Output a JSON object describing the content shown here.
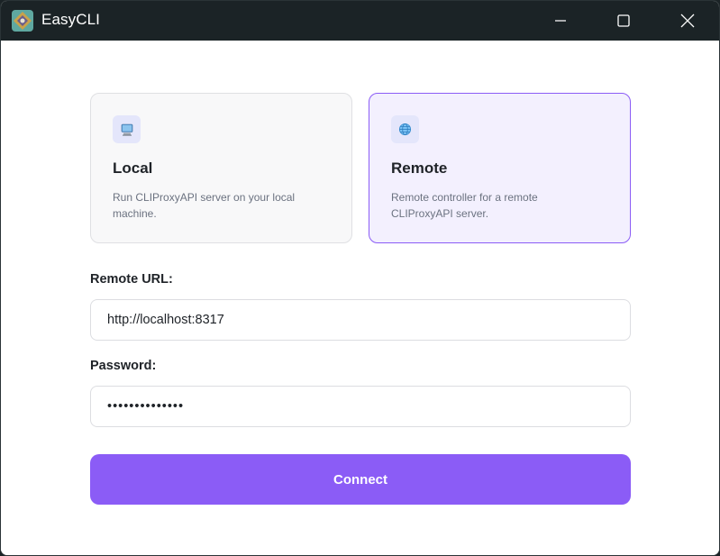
{
  "window": {
    "title": "EasyCLI",
    "controls": {
      "minimize": "minimize-icon",
      "maximize": "maximize-icon",
      "close": "close-icon"
    }
  },
  "modes": [
    {
      "title": "Local",
      "description": "Run CLIProxyAPI server on your local machine.",
      "icon": "computer-icon",
      "selected": false
    },
    {
      "title": "Remote",
      "description": "Remote controller for a remote CLIProxyAPI server.",
      "icon": "globe-icon",
      "selected": true
    }
  ],
  "form": {
    "remote_url_label": "Remote URL:",
    "remote_url_value": "http://localhost:8317",
    "password_label": "Password:",
    "password_value": "••••••••••••••"
  },
  "connect_label": "Connect",
  "colors": {
    "accent": "#8b5cf6",
    "titlebar": "#1b2326",
    "selected_card_bg": "#f3f0fe"
  }
}
